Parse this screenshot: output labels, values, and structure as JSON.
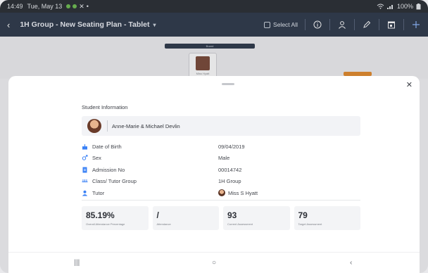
{
  "status_bar": {
    "time": "14:49",
    "date": "Tue, May 13",
    "battery": "100%"
  },
  "app_bar": {
    "title": "1H Group - New Seating Plan - Tablet",
    "select_all": "Select All",
    "icons": [
      "back-arrow-icon",
      "chevron-down-icon",
      "info-icon",
      "person-icon",
      "edit-icon",
      "calendar-icon",
      "add-icon"
    ]
  },
  "canvas": {
    "board_label": "Board",
    "seat_name": "Miss Hyatt"
  },
  "sheet": {
    "heading": "Student Information",
    "guardian_name": "Anne-Marie & Michael Devlin",
    "rows": [
      {
        "label": "Date of Birth",
        "value": "09/04/2019",
        "icon": "cake-icon"
      },
      {
        "label": "Sex",
        "value": "Male",
        "icon": "gender-icon"
      },
      {
        "label": "Admission No",
        "value": "00014742",
        "icon": "document-icon"
      },
      {
        "label": "Class/ Tutor Group",
        "value": "1H Group",
        "icon": "class-icon"
      },
      {
        "label": "Tutor",
        "value": "Miss S Hyatt",
        "icon": "person-icon"
      }
    ],
    "stats": [
      {
        "value": "85.19%",
        "label": "Overall Attendance Percentage"
      },
      {
        "value": "/",
        "label": "Attendance"
      },
      {
        "value": "93",
        "label": "Current Assessment"
      },
      {
        "value": "79",
        "label": "Target Assessment"
      }
    ]
  },
  "nav": {
    "recents": "|||",
    "home": "○",
    "back": "‹"
  },
  "colors": {
    "app_bar": "#2f3b4c",
    "status_bar": "#2b2f35",
    "accent_blue": "#3b82f6"
  }
}
